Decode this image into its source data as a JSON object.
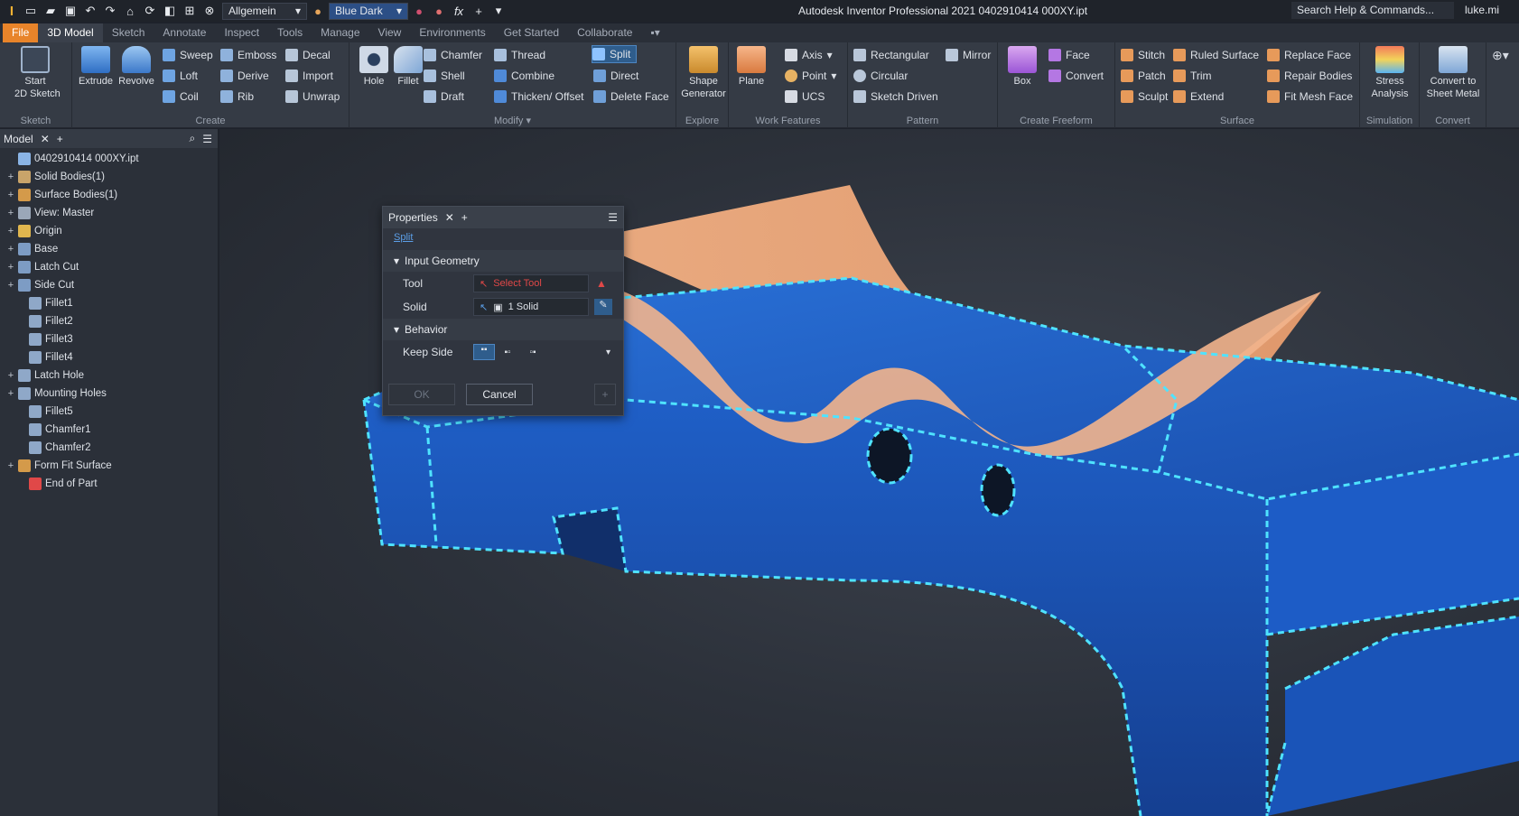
{
  "titlebar": {
    "app_title": "Autodesk Inventor Professional 2021    0402910414 000XY.ipt",
    "style_combo": "Allgemein",
    "theme_combo": "Blue Dark",
    "search_placeholder": "Search Help & Commands...",
    "user": "luke.mi"
  },
  "tabs": [
    "File",
    "3D Model",
    "Sketch",
    "Annotate",
    "Inspect",
    "Tools",
    "Manage",
    "View",
    "Environments",
    "Get Started",
    "Collaborate"
  ],
  "ribbon": {
    "sketch": {
      "label": "Sketch",
      "start": "Start\n2D Sketch"
    },
    "create": {
      "label": "Create",
      "extrude": "Extrude",
      "revolve": "Revolve",
      "sweep": "Sweep",
      "loft": "Loft",
      "coil": "Coil",
      "emboss": "Emboss",
      "derive": "Derive",
      "rib": "Rib",
      "decal": "Decal",
      "import": "Import",
      "unwrap": "Unwrap"
    },
    "modify": {
      "label": "Modify",
      "hole": "Hole",
      "fillet": "Fillet",
      "chamfer": "Chamfer",
      "shell": "Shell",
      "draft": "Draft",
      "thread": "Thread",
      "combine": "Combine",
      "thicken": "Thicken/ Offset",
      "split": "Split",
      "direct": "Direct",
      "delete_face": "Delete Face"
    },
    "explore": {
      "label": "Explore",
      "shape_generator": "Shape\nGenerator"
    },
    "work_features": {
      "label": "Work Features",
      "plane": "Plane",
      "axis": "Axis",
      "point": "Point",
      "ucs": "UCS"
    },
    "pattern": {
      "label": "Pattern",
      "rectangular": "Rectangular",
      "circular": "Circular",
      "sketch_driven": "Sketch Driven",
      "mirror": "Mirror"
    },
    "create_freeform": {
      "label": "Create Freeform",
      "box": "Box",
      "face": "Face",
      "convert": "Convert"
    },
    "surface": {
      "label": "Surface",
      "stitch": "Stitch",
      "patch": "Patch",
      "sculpt": "Sculpt",
      "ruled_surface": "Ruled Surface",
      "trim": "Trim",
      "extend": "Extend",
      "replace_face": "Replace Face",
      "repair_bodies": "Repair Bodies",
      "fit_mesh_face": "Fit Mesh Face"
    },
    "simulation": {
      "label": "Simulation",
      "stress": "Stress\nAnalysis"
    },
    "convert": {
      "label": "Convert",
      "sheet_metal": "Convert to\nSheet Metal"
    }
  },
  "browser": {
    "tab": "Model",
    "items": [
      {
        "label": "0402910414 000XY.ipt",
        "expand": "",
        "indent": 0,
        "color": "#8ab4e6"
      },
      {
        "label": "Solid Bodies(1)",
        "expand": "+",
        "indent": 0,
        "color": "#c9a46a"
      },
      {
        "label": "Surface Bodies(1)",
        "expand": "+",
        "indent": 0,
        "color": "#d49a4a"
      },
      {
        "label": "View: Master",
        "expand": "+",
        "indent": 0,
        "color": "#9aa7b8"
      },
      {
        "label": "Origin",
        "expand": "+",
        "indent": 0,
        "color": "#e0b64e"
      },
      {
        "label": "Base",
        "expand": "+",
        "indent": 0,
        "color": "#7d9cc4"
      },
      {
        "label": "Latch Cut",
        "expand": "+",
        "indent": 0,
        "color": "#7d9cc4"
      },
      {
        "label": "Side Cut",
        "expand": "+",
        "indent": 0,
        "color": "#7d9cc4"
      },
      {
        "label": "Fillet1",
        "expand": "",
        "indent": 1,
        "color": "#8fa8c8"
      },
      {
        "label": "Fillet2",
        "expand": "",
        "indent": 1,
        "color": "#8fa8c8"
      },
      {
        "label": "Fillet3",
        "expand": "",
        "indent": 1,
        "color": "#8fa8c8"
      },
      {
        "label": "Fillet4",
        "expand": "",
        "indent": 1,
        "color": "#8fa8c8"
      },
      {
        "label": "Latch Hole",
        "expand": "+",
        "indent": 0,
        "color": "#8fa8c8"
      },
      {
        "label": "Mounting Holes",
        "expand": "+",
        "indent": 0,
        "color": "#8fa8c8"
      },
      {
        "label": "Fillet5",
        "expand": "",
        "indent": 1,
        "color": "#8fa8c8"
      },
      {
        "label": "Chamfer1",
        "expand": "",
        "indent": 1,
        "color": "#8fa8c8"
      },
      {
        "label": "Chamfer2",
        "expand": "",
        "indent": 1,
        "color": "#8fa8c8"
      },
      {
        "label": "Form Fit Surface",
        "expand": "+",
        "indent": 0,
        "color": "#d49a4a"
      },
      {
        "label": "End of Part",
        "expand": "",
        "indent": 1,
        "color": "#e04848"
      }
    ]
  },
  "properties": {
    "title": "Properties",
    "command_link": "Split",
    "input_geometry": "Input Geometry",
    "tool_label": "Tool",
    "tool_value": "Select Tool",
    "solid_label": "Solid",
    "solid_value": "1 Solid",
    "behavior": "Behavior",
    "keep_side_label": "Keep Side",
    "ok": "OK",
    "cancel": "Cancel"
  },
  "colors": {
    "accent": "#e8842a",
    "selection": "#2f5d8c",
    "part_blue": "#1f5fbf",
    "surface_peach": "#f0ab7c",
    "highlight": "#4fe3ff",
    "warning": "#e04848"
  }
}
